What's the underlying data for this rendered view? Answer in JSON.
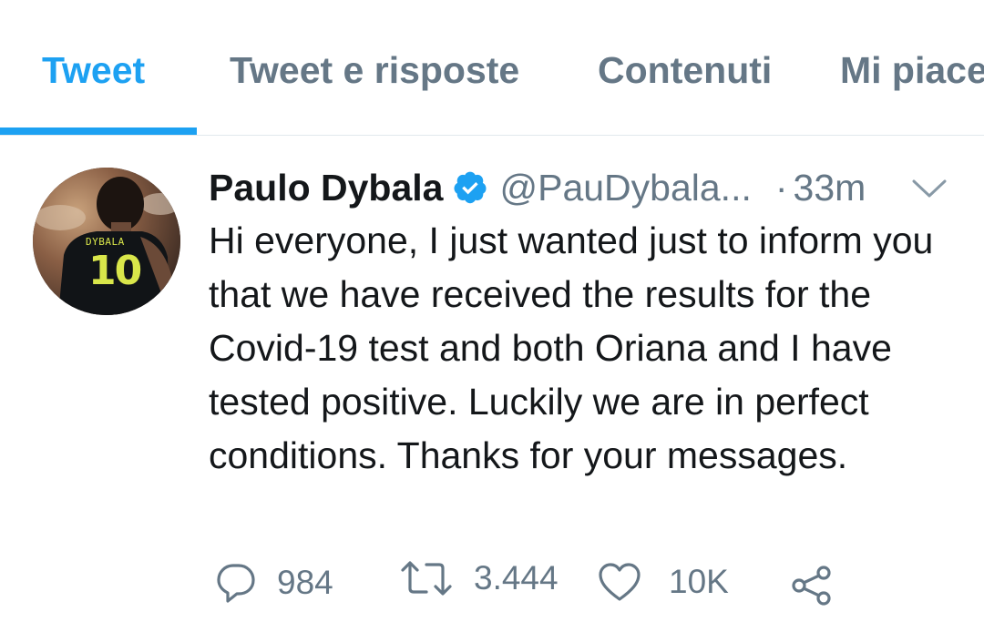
{
  "tabs": [
    {
      "label": "Tweet",
      "active": true
    },
    {
      "label": "Tweet e risposte",
      "active": false
    },
    {
      "label": "Contenuti",
      "active": false
    },
    {
      "label": "Mi piace",
      "active": false
    }
  ],
  "tweet": {
    "author_name": "Paulo Dybala",
    "verified": true,
    "handle": "@PauDybala...",
    "separator": "·",
    "time": "33m",
    "avatar": {
      "jersey_name": "DYBALA",
      "jersey_number": "10"
    },
    "text": "Hi everyone, I just wanted just  to inform you that we have received the results for the Covid-19 test and both Oriana and I have tested positive. Luckily we are in perfect conditions. Thanks for your messages.",
    "actions": {
      "reply_count": "984",
      "retweet_count": "3.444",
      "like_count": "10K"
    }
  },
  "colors": {
    "accent": "#1da1f2",
    "muted": "#657786",
    "text": "#14171a",
    "divider": "#e1e8ed"
  },
  "icons": [
    "verified-badge-icon",
    "chevron-down-icon",
    "reply-icon",
    "retweet-icon",
    "like-icon",
    "share-icon"
  ]
}
